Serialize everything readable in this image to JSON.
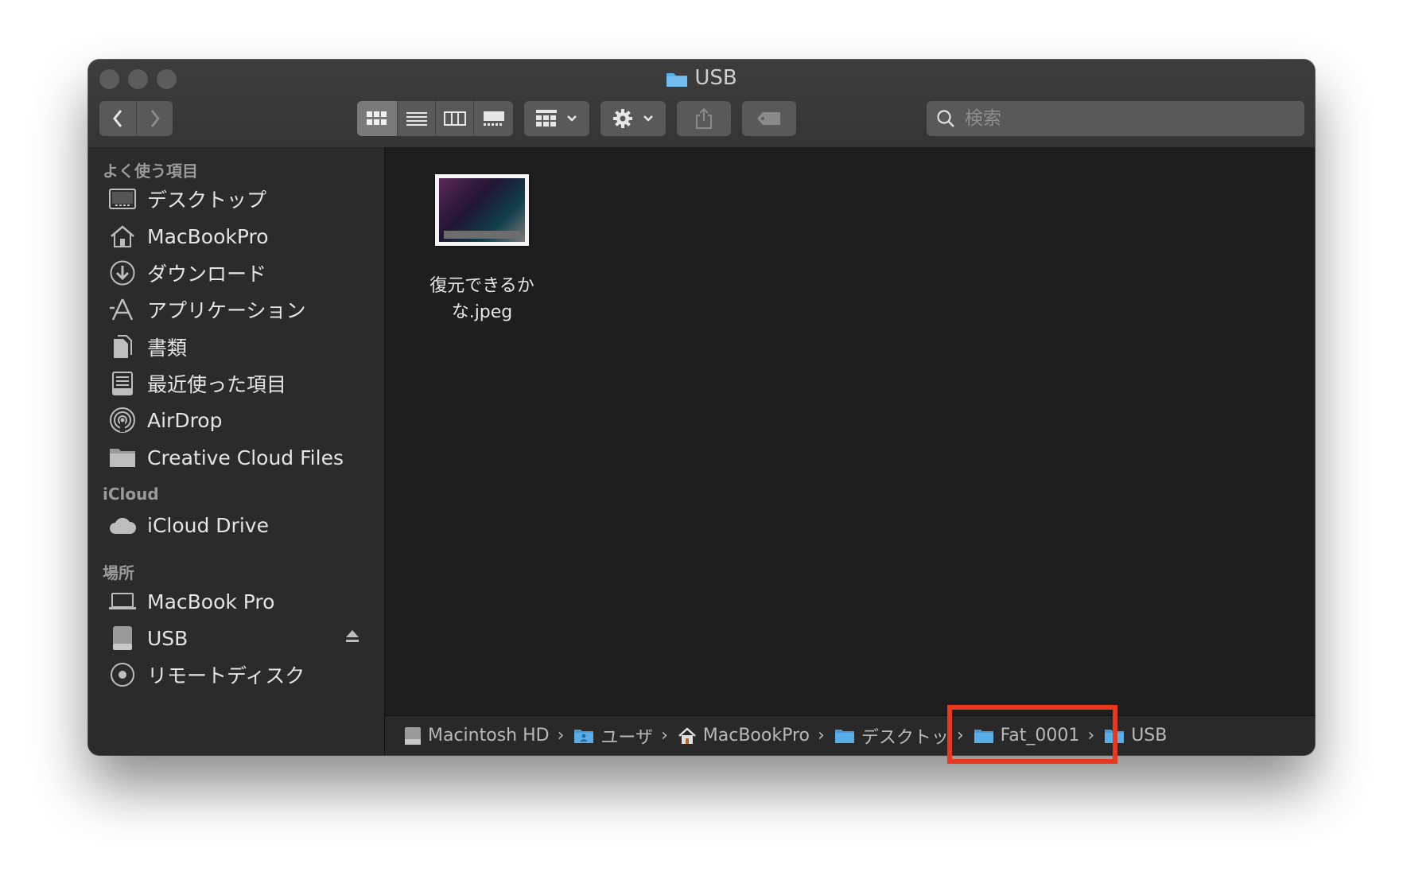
{
  "window": {
    "title": "USB"
  },
  "toolbar": {
    "back_icon": "chevron-left-icon",
    "forward_icon": "chevron-right-icon",
    "view_modes": [
      "icon-view",
      "list-view",
      "column-view",
      "gallery-view"
    ],
    "active_view": "icon-view",
    "group_icon": "group-by-icon",
    "action_icon": "gear-icon",
    "share_icon": "share-icon",
    "tag_icon": "tag-icon"
  },
  "search": {
    "placeholder": "検索",
    "value": ""
  },
  "sidebar": {
    "favorites_header": "よく使う項目",
    "favorites": [
      {
        "label": "デスクトップ",
        "icon": "desktop-icon"
      },
      {
        "label": "MacBookPro",
        "icon": "home-icon"
      },
      {
        "label": "ダウンロード",
        "icon": "downloads-icon"
      },
      {
        "label": "アプリケーション",
        "icon": "applications-icon"
      },
      {
        "label": "書類",
        "icon": "documents-icon"
      },
      {
        "label": "最近使った項目",
        "icon": "recents-icon"
      },
      {
        "label": "AirDrop",
        "icon": "airdrop-icon"
      },
      {
        "label": "Creative Cloud Files",
        "icon": "folder-icon"
      }
    ],
    "icloud_header": "iCloud",
    "icloud": [
      {
        "label": "iCloud Drive",
        "icon": "cloud-icon"
      }
    ],
    "locations_header": "場所",
    "locations": [
      {
        "label": "MacBook Pro",
        "icon": "laptop-icon"
      },
      {
        "label": "USB",
        "icon": "external-drive-icon",
        "eject": true
      },
      {
        "label": "リモートディスク",
        "icon": "remote-disc-icon"
      }
    ]
  },
  "content": {
    "files": [
      {
        "name": "復元できるかな.jpeg",
        "name_line1": "復元できるか",
        "name_line2": "な.jpeg",
        "icon": "image-thumbnail"
      }
    ]
  },
  "pathbar": {
    "items": [
      {
        "label": "Macintosh HD",
        "icon": "hard-drive-icon"
      },
      {
        "label": "ユーザ",
        "icon": "users-folder-icon"
      },
      {
        "label": "MacBookPro",
        "icon": "home-icon"
      },
      {
        "label": "デスクトッ",
        "icon": "folder-icon"
      },
      {
        "label": "Fat_0001",
        "icon": "folder-icon"
      },
      {
        "label": "USB",
        "icon": "folder-icon"
      }
    ]
  },
  "colors": {
    "highlight": "#e8381f",
    "folder": "#5aaee8"
  }
}
